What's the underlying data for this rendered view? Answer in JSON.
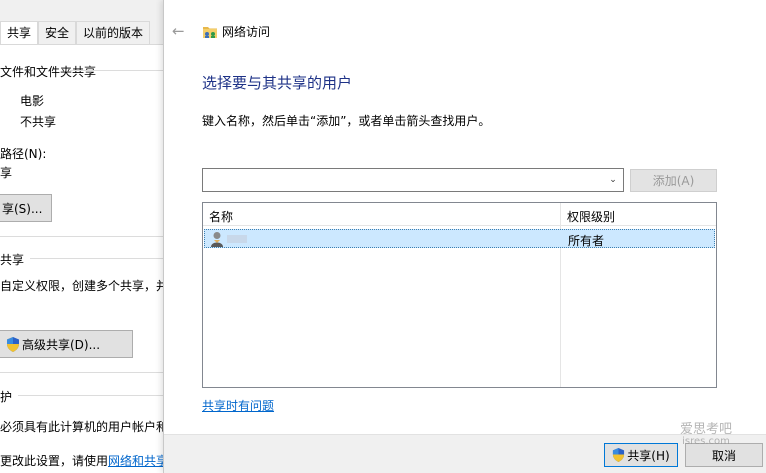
{
  "background_window": {
    "tabs": [
      "共享",
      "安全",
      "以前的版本"
    ],
    "section_title": "文件和文件夹共享",
    "item_name": "电影",
    "item_status": "不共享",
    "path_label": "路径(N):",
    "path_value": "享",
    "share_button": "享(S)...",
    "advanced_section": "共享",
    "advanced_desc": "自定义权限，创建多个共享，并设",
    "advanced_button": "高级共享(D)...",
    "password_section": "护",
    "password_desc": "必须具有此计算机的用户帐户和密",
    "change_prefix": "更改此设置，请使用",
    "change_link": "网络和共享中"
  },
  "dialog": {
    "title": "网络访问",
    "heading": "选择要与其共享的用户",
    "instruction": "键入名称，然后单击“添加”，或者单击箭头查找用户。",
    "input_value": "",
    "add_button": "添加(A)",
    "columns": [
      "名称",
      "权限级别"
    ],
    "rows": [
      {
        "name": "",
        "permission": "所有者"
      }
    ],
    "help_link": "共享时有问题",
    "share_button": "共享(H)",
    "cancel_button": "取消"
  },
  "watermark": {
    "line1": "爱思考吧",
    "line2": "isres.com"
  },
  "colors": {
    "heading": "#1e3287",
    "link": "#0066cc",
    "selection": "#cce8ff"
  }
}
